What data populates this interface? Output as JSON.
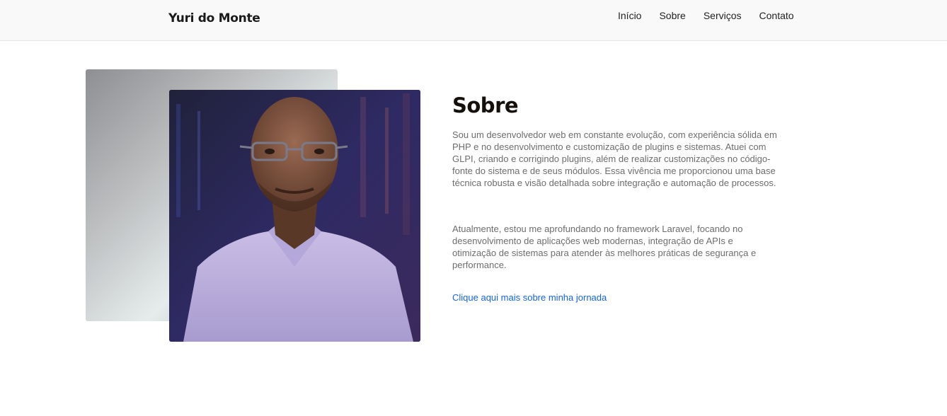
{
  "header": {
    "brand": "Yuri do Monte",
    "nav": [
      {
        "label": "Início"
      },
      {
        "label": "Sobre"
      },
      {
        "label": "Serviços"
      },
      {
        "label": "Contato"
      }
    ]
  },
  "about": {
    "title": "Sobre",
    "paragraphs": [
      "Sou um desenvolvedor web em constante evolução, com experiência sólida em PHP e no desenvolvimento e customização de plugins e sistemas. Atuei com GLPI, criando e corrigindo plugins, além de realizar customizações no código-fonte do sistema e de seus módulos. Essa vivência me proporcionou uma base técnica robusta e visão detalhada sobre integração e automação de processos.",
      "Atualmente, estou me aprofundando no framework Laravel, focando no desenvolvimento de aplicações web modernas, integração de APIs e otimização de sistemas para atender às melhores práticas de segurança e performance."
    ],
    "link_label": "Clique aqui mais sobre minha jornada"
  },
  "colors": {
    "header_bg": "#f9f9f9",
    "title": "#16100c",
    "body_text": "#6d6d6d",
    "link": "#1565d8"
  }
}
